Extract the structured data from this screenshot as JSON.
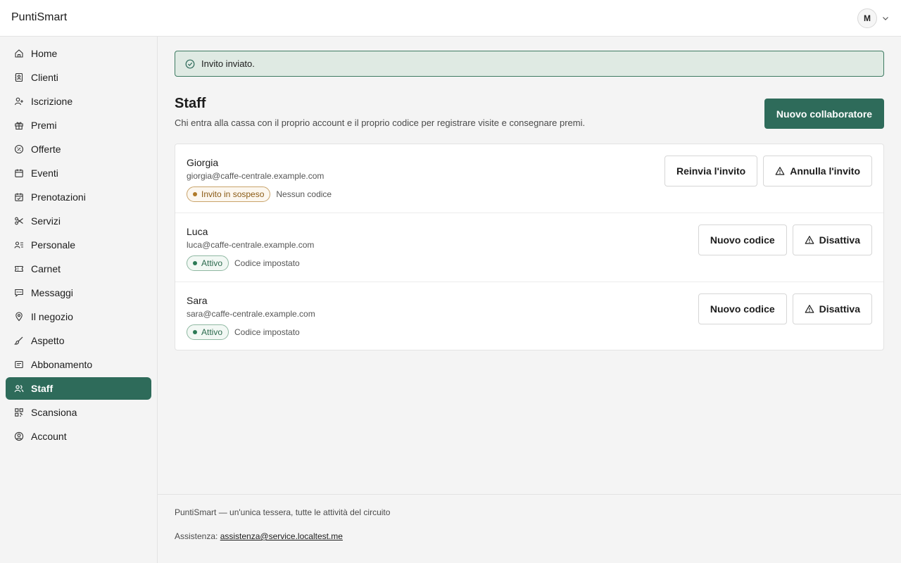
{
  "app": {
    "brand": "PuntiSmart"
  },
  "user": {
    "avatar_initial": "M"
  },
  "sidebar": {
    "items": [
      {
        "label": "Home",
        "icon": "home-icon"
      },
      {
        "label": "Clienti",
        "icon": "contacts-icon"
      },
      {
        "label": "Iscrizione",
        "icon": "user-plus-icon"
      },
      {
        "label": "Premi",
        "icon": "gift-icon"
      },
      {
        "label": "Offerte",
        "icon": "badge-percent-icon"
      },
      {
        "label": "Eventi",
        "icon": "calendar-icon"
      },
      {
        "label": "Prenotazioni",
        "icon": "calendar-check-icon"
      },
      {
        "label": "Servizi",
        "icon": "scissors-icon"
      },
      {
        "label": "Personale",
        "icon": "users-list-icon"
      },
      {
        "label": "Carnet",
        "icon": "ticket-icon"
      },
      {
        "label": "Messaggi",
        "icon": "message-icon"
      },
      {
        "label": "Il negozio",
        "icon": "map-pin-icon"
      },
      {
        "label": "Aspetto",
        "icon": "brush-icon"
      },
      {
        "label": "Abbonamento",
        "icon": "receipt-icon"
      },
      {
        "label": "Staff",
        "icon": "users-icon",
        "active": true
      },
      {
        "label": "Scansiona",
        "icon": "qr-icon"
      },
      {
        "label": "Account",
        "icon": "user-circle-icon"
      }
    ]
  },
  "alert": {
    "text": "Invito inviato."
  },
  "page": {
    "title": "Staff",
    "subtitle": "Chi entra alla cassa con il proprio account e il proprio codice per registrare visite e consegnare premi.",
    "primary_action": "Nuovo collaboratore"
  },
  "staff": [
    {
      "name": "Giorgia",
      "email": "giorgia@caffe-centrale.example.com",
      "status": "Invito in sospeso",
      "status_type": "pending",
      "code": "Nessun codice",
      "actions": [
        {
          "label": "Reinvia l'invito",
          "warning": false
        },
        {
          "label": "Annulla l'invito",
          "warning": true
        }
      ]
    },
    {
      "name": "Luca",
      "email": "luca@caffe-centrale.example.com",
      "status": "Attivo",
      "status_type": "active",
      "code": "Codice impostato",
      "actions": [
        {
          "label": "Nuovo codice",
          "warning": false
        },
        {
          "label": "Disattiva",
          "warning": true
        }
      ]
    },
    {
      "name": "Sara",
      "email": "sara@caffe-centrale.example.com",
      "status": "Attivo",
      "status_type": "active",
      "code": "Codice impostato",
      "actions": [
        {
          "label": "Nuovo codice",
          "warning": false
        },
        {
          "label": "Disattiva",
          "warning": true
        }
      ]
    }
  ],
  "footer": {
    "tagline": "PuntiSmart — un'unica tessera, tutte le attività del circuito",
    "support_label": "Assistenza:",
    "support_email": "assistenza@service.localtest.me"
  },
  "colors": {
    "accent": "#2e6b5a",
    "alert_bg": "#dfeae3",
    "pending": "#b07a28",
    "active": "#2b7a55"
  }
}
